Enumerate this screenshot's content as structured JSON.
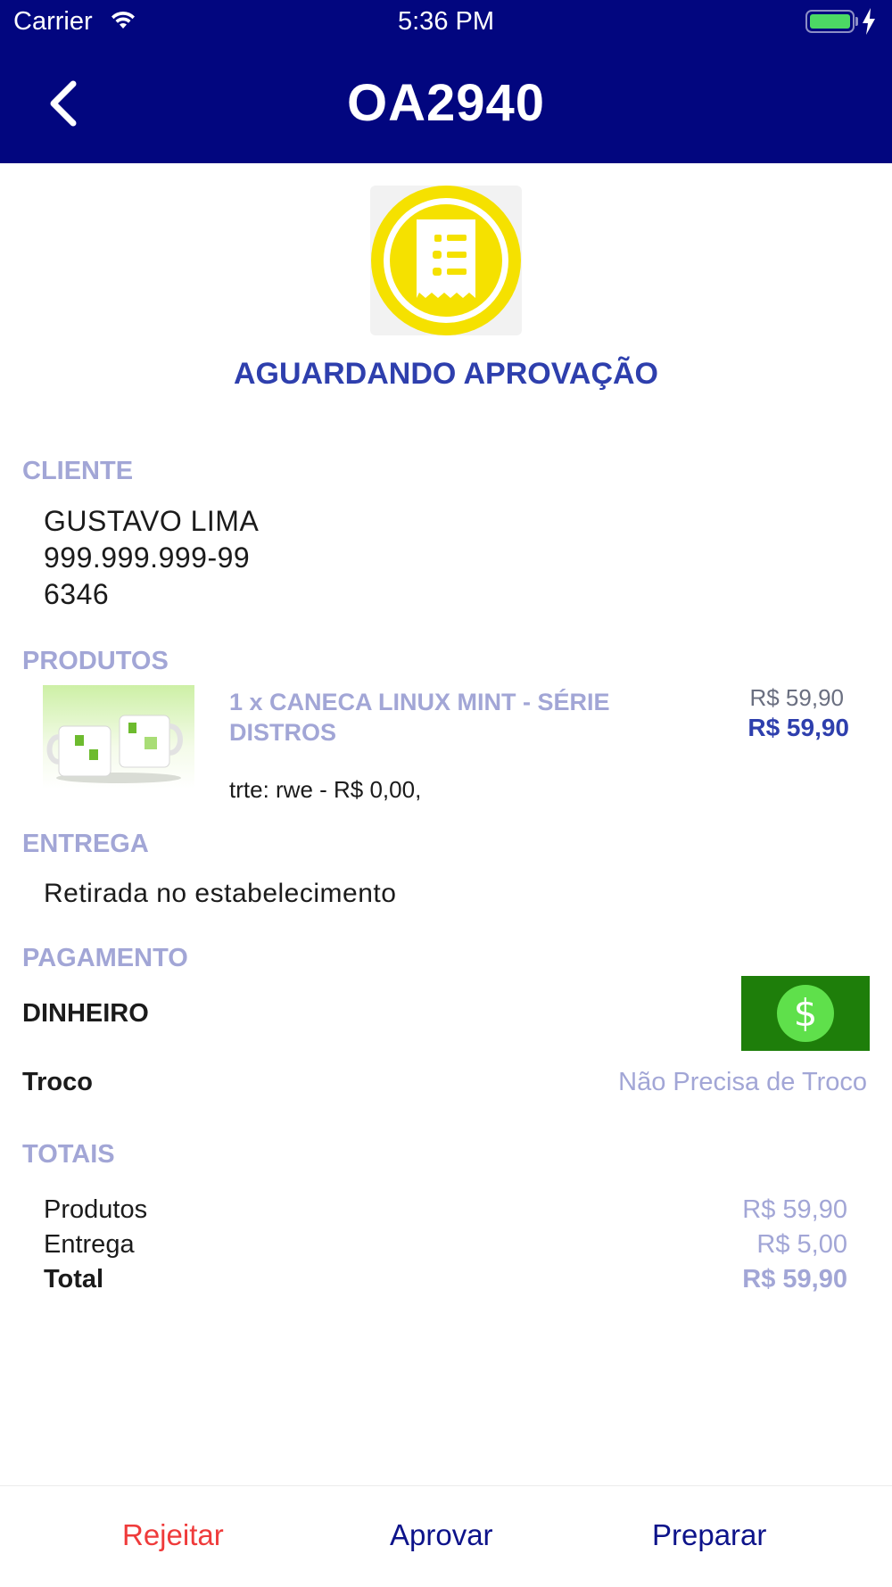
{
  "status_bar": {
    "carrier": "Carrier",
    "time": "5:36 PM"
  },
  "header": {
    "title": "OA2940"
  },
  "order_status": {
    "label": "AGUARDANDO APROVAÇÃO",
    "icon": "receipt-icon",
    "color": "#f5e100"
  },
  "cliente": {
    "title": "CLIENTE",
    "name": "GUSTAVO LIMA",
    "document": "999.999.999-99",
    "code": "6346"
  },
  "produtos": {
    "title": "PRODUTOS",
    "items": [
      {
        "name": "1 x CANECA LINUX MINT - SÉRIE DISTROS",
        "unit_price": "R$ 59,90",
        "total_price": "R$ 59,90",
        "options": "trte: rwe  -  R$ 0,00,"
      }
    ]
  },
  "entrega": {
    "title": "ENTREGA",
    "method": "Retirada no estabelecimento"
  },
  "pagamento": {
    "title": "PAGAMENTO",
    "method": "DINHEIRO",
    "method_icon": "dollar-icon",
    "change_label": "Troco",
    "change_value": "Não Precisa de Troco"
  },
  "totais": {
    "title": "TOTAIS",
    "rows": [
      {
        "label": "Produtos",
        "value": "R$ 59,90"
      },
      {
        "label": "Entrega",
        "value": "R$ 5,00"
      },
      {
        "label": "Total",
        "value": "R$ 59,90"
      }
    ]
  },
  "actions": {
    "reject": "Rejeitar",
    "approve": "Aprovar",
    "prepare": "Preparar"
  },
  "colors": {
    "nav": "#02067f",
    "accent": "#2e3fad",
    "muted": "#a2a6d6",
    "danger": "#ef3b3b",
    "cash": "#1e7e0a"
  }
}
